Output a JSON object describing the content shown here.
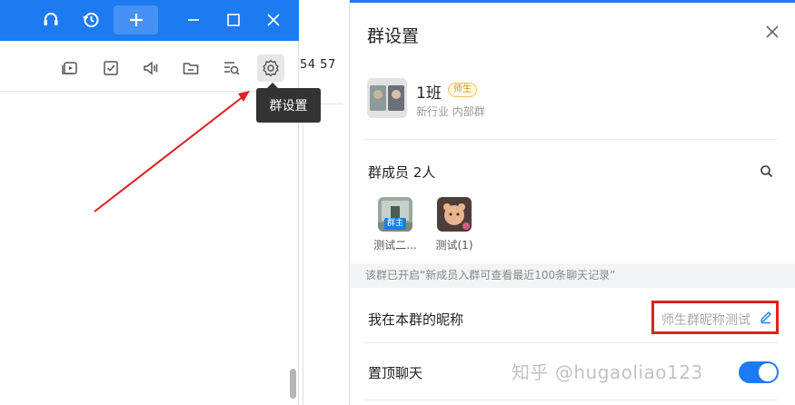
{
  "left_window": {
    "toolbar_numbers": "54 57",
    "tooltip": "群设置"
  },
  "panel": {
    "title": "群设置",
    "group": {
      "name": "1班",
      "badge": "师生",
      "subtitle": "新行业 内部群"
    },
    "members": {
      "title": "群成员 2人",
      "items": [
        {
          "name": "测试二...",
          "tag": "群主"
        },
        {
          "name": "测试(1)"
        }
      ]
    },
    "notice": "该群已开启“新成员入群可查看最近100条聊天记录”",
    "nickname": {
      "label": "我在本群的昵称",
      "value": "师生群昵称测试"
    },
    "pin": {
      "label": "置顶聊天",
      "enabled": true
    },
    "watermark": "知乎 @hugaoliao123"
  },
  "colors": {
    "accent": "#1d7bf2",
    "highlight_red": "#e02020"
  }
}
